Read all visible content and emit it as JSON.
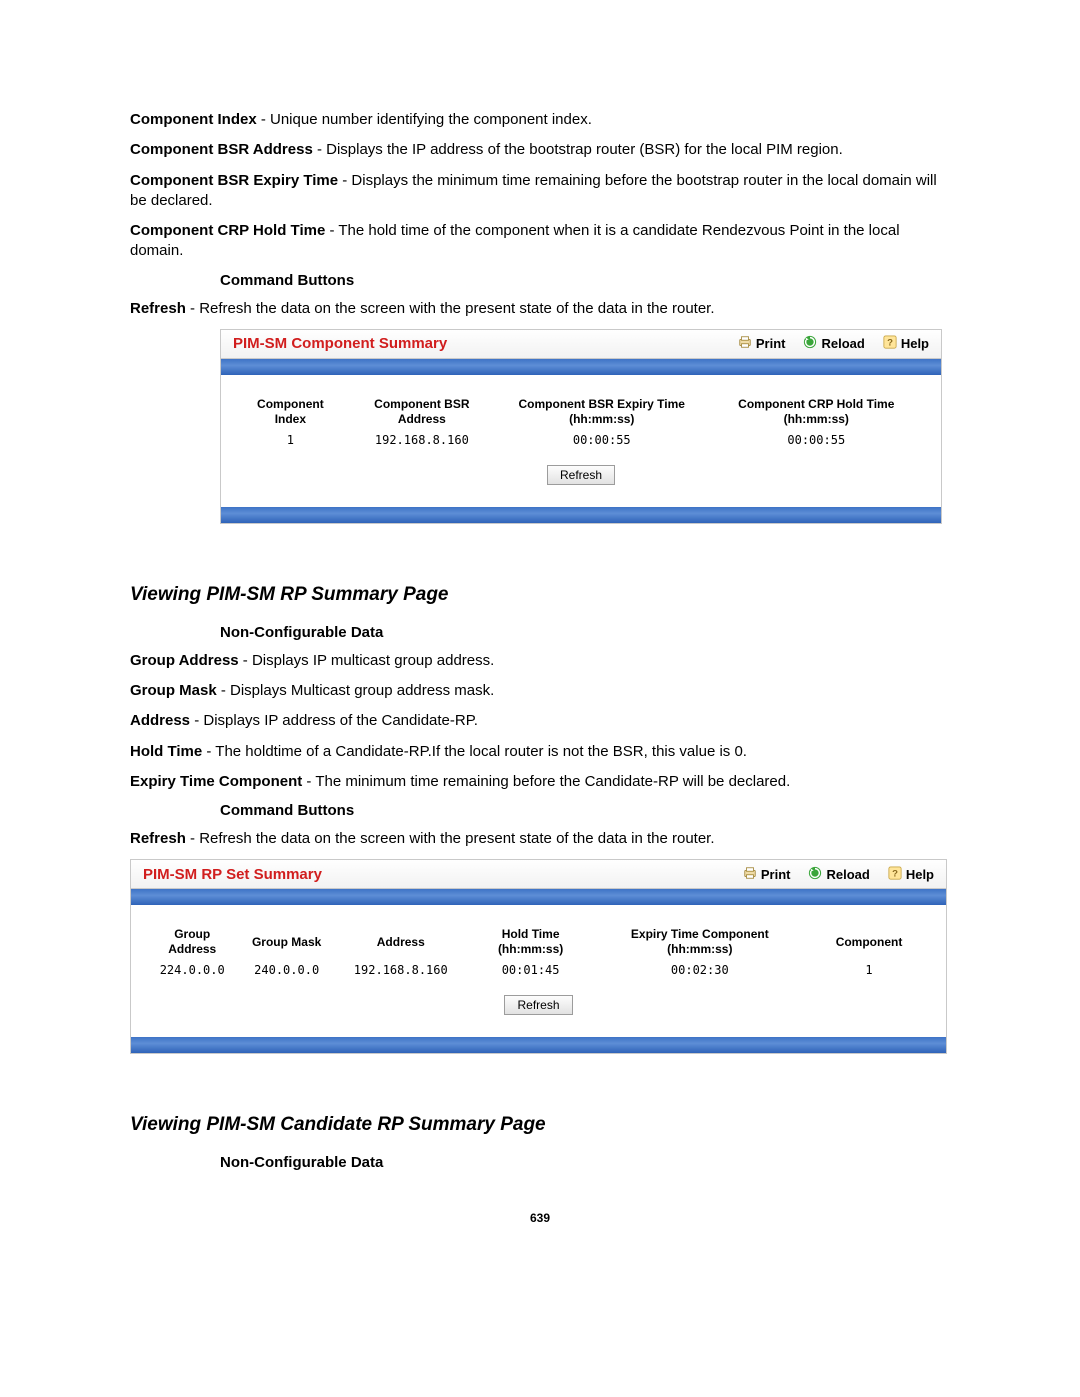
{
  "defs": {
    "component_index": {
      "term": "Component Index",
      "text": " - Unique number identifying the component index."
    },
    "component_bsr_address": {
      "term": "Component BSR Address",
      "text": " - Displays the IP address of the bootstrap router (BSR) for the local PIM region."
    },
    "component_bsr_expiry": {
      "term": "Component BSR Expiry Time",
      "text": " - Displays the minimum time remaining before the bootstrap router in the local domain will be declared."
    },
    "component_crp_hold": {
      "term": "Component CRP Hold Time",
      "text": " - The hold time of the component when it is a candidate Rendezvous Point in the local domain."
    },
    "command_buttons_1": "Command Buttons",
    "refresh_1": {
      "term": "Refresh",
      "text": " - Refresh the data on the screen with the present state of the data in the router."
    }
  },
  "panel1": {
    "title": "PIM-SM Component Summary",
    "actions": {
      "print": "Print",
      "reload": "Reload",
      "help": "Help"
    },
    "headers": {
      "c0": "Component Index",
      "c1": "Component BSR Address",
      "c2_a": "Component BSR Expiry Time",
      "c2_b": "(hh:mm:ss)",
      "c3_a": "Component CRP Hold Time",
      "c3_b": "(hh:mm:ss)"
    },
    "row": {
      "c0": "1",
      "c1": "192.168.8.160",
      "c2": "00:00:55",
      "c3": "00:00:55"
    },
    "refresh_label": "Refresh"
  },
  "section2": {
    "title": "Viewing PIM-SM RP Summary Page",
    "noncfg": "Non-Configurable Data",
    "group_address": {
      "term": "Group Address",
      "text": " - Displays IP multicast group address."
    },
    "group_mask": {
      "term": "Group Mask",
      "text": " - Displays Multicast group address mask."
    },
    "address": {
      "term": "Address",
      "text": " - Displays IP address of the Candidate-RP."
    },
    "hold_time": {
      "term": "Hold Time",
      "text": " - The holdtime of a Candidate-RP.If the local router is not the BSR, this value is 0."
    },
    "expiry": {
      "term": "Expiry Time Component",
      "text": " - The minimum time remaining before the Candidate-RP will be declared."
    },
    "command_buttons": "Command Buttons",
    "refresh": {
      "term": "Refresh",
      "text": " - Refresh the data on the screen with the present state of the data in the router."
    }
  },
  "panel2": {
    "title": "PIM-SM RP Set Summary",
    "actions": {
      "print": "Print",
      "reload": "Reload",
      "help": "Help"
    },
    "headers": {
      "c0": "Group Address",
      "c1": "Group Mask",
      "c2": "Address",
      "c3_a": "Hold Time",
      "c3_b": "(hh:mm:ss)",
      "c4_a": "Expiry Time Component",
      "c4_b": "(hh:mm:ss)",
      "c5": "Component"
    },
    "row": {
      "c0": "224.0.0.0",
      "c1": "240.0.0.0",
      "c2": "192.168.8.160",
      "c3": "00:01:45",
      "c4": "00:02:30",
      "c5": "1"
    },
    "refresh_label": "Refresh"
  },
  "section3": {
    "title": "Viewing PIM-SM Candidate RP Summary Page",
    "noncfg": "Non-Configurable Data"
  },
  "page_number": "639"
}
